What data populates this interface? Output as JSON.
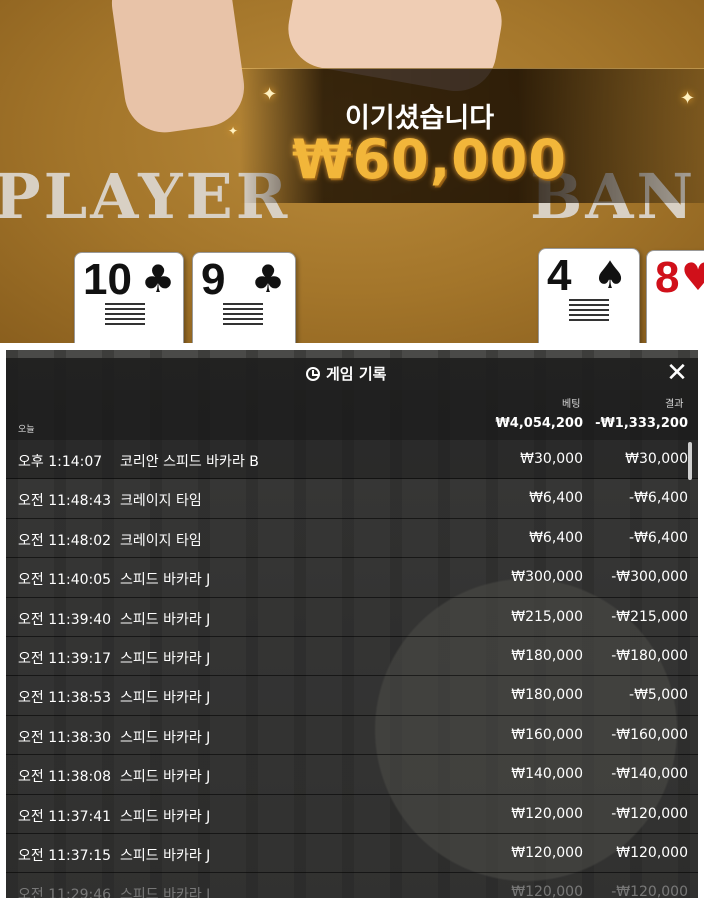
{
  "video": {
    "felt_player": "PLAYER",
    "felt_banker": "BAN",
    "win_title": "이기셨습니다",
    "win_amount": "₩60,000",
    "cards": [
      {
        "rank": "10",
        "suit": "♣",
        "color": "#111111"
      },
      {
        "rank": "9",
        "suit": "♣",
        "color": "#111111"
      },
      {
        "rank": "4",
        "suit": "♠",
        "color": "#111111"
      },
      {
        "rank": "8",
        "suit": "♥",
        "color": "#d0101a"
      }
    ]
  },
  "history": {
    "title": "게임 기록",
    "title_icon": "history-icon",
    "close_icon": "close-icon",
    "col_bet": "베팅",
    "col_result": "결과",
    "today_label": "오늘",
    "total_bet": "₩4,054,200",
    "total_result": "-₩1,333,200",
    "rows": [
      {
        "time": "오후 1:14:07",
        "game": "코리안 스피드 바카라 B",
        "bet": "₩30,000",
        "result": "₩30,000"
      },
      {
        "time": "오전 11:48:43",
        "game": "크레이지 타임",
        "bet": "₩6,400",
        "result": "-₩6,400"
      },
      {
        "time": "오전 11:48:02",
        "game": "크레이지 타임",
        "bet": "₩6,400",
        "result": "-₩6,400"
      },
      {
        "time": "오전 11:40:05",
        "game": "스피드 바카라 J",
        "bet": "₩300,000",
        "result": "-₩300,000"
      },
      {
        "time": "오전 11:39:40",
        "game": "스피드 바카라 J",
        "bet": "₩215,000",
        "result": "-₩215,000"
      },
      {
        "time": "오전 11:39:17",
        "game": "스피드 바카라 J",
        "bet": "₩180,000",
        "result": "-₩180,000"
      },
      {
        "time": "오전 11:38:53",
        "game": "스피드 바카라 J",
        "bet": "₩180,000",
        "result": "-₩5,000"
      },
      {
        "time": "오전 11:38:30",
        "game": "스피드 바카라 J",
        "bet": "₩160,000",
        "result": "-₩160,000"
      },
      {
        "time": "오전 11:38:08",
        "game": "스피드 바카라 J",
        "bet": "₩140,000",
        "result": "-₩140,000"
      },
      {
        "time": "오전 11:37:41",
        "game": "스피드 바카라 J",
        "bet": "₩120,000",
        "result": "-₩120,000"
      },
      {
        "time": "오전 11:37:15",
        "game": "스피드 바카라 J",
        "bet": "₩120,000",
        "result": "₩120,000"
      },
      {
        "time": "오전 11:29:46",
        "game": "스피드 바카라 J",
        "bet": "₩120,000",
        "result": "-₩120,000"
      }
    ]
  }
}
